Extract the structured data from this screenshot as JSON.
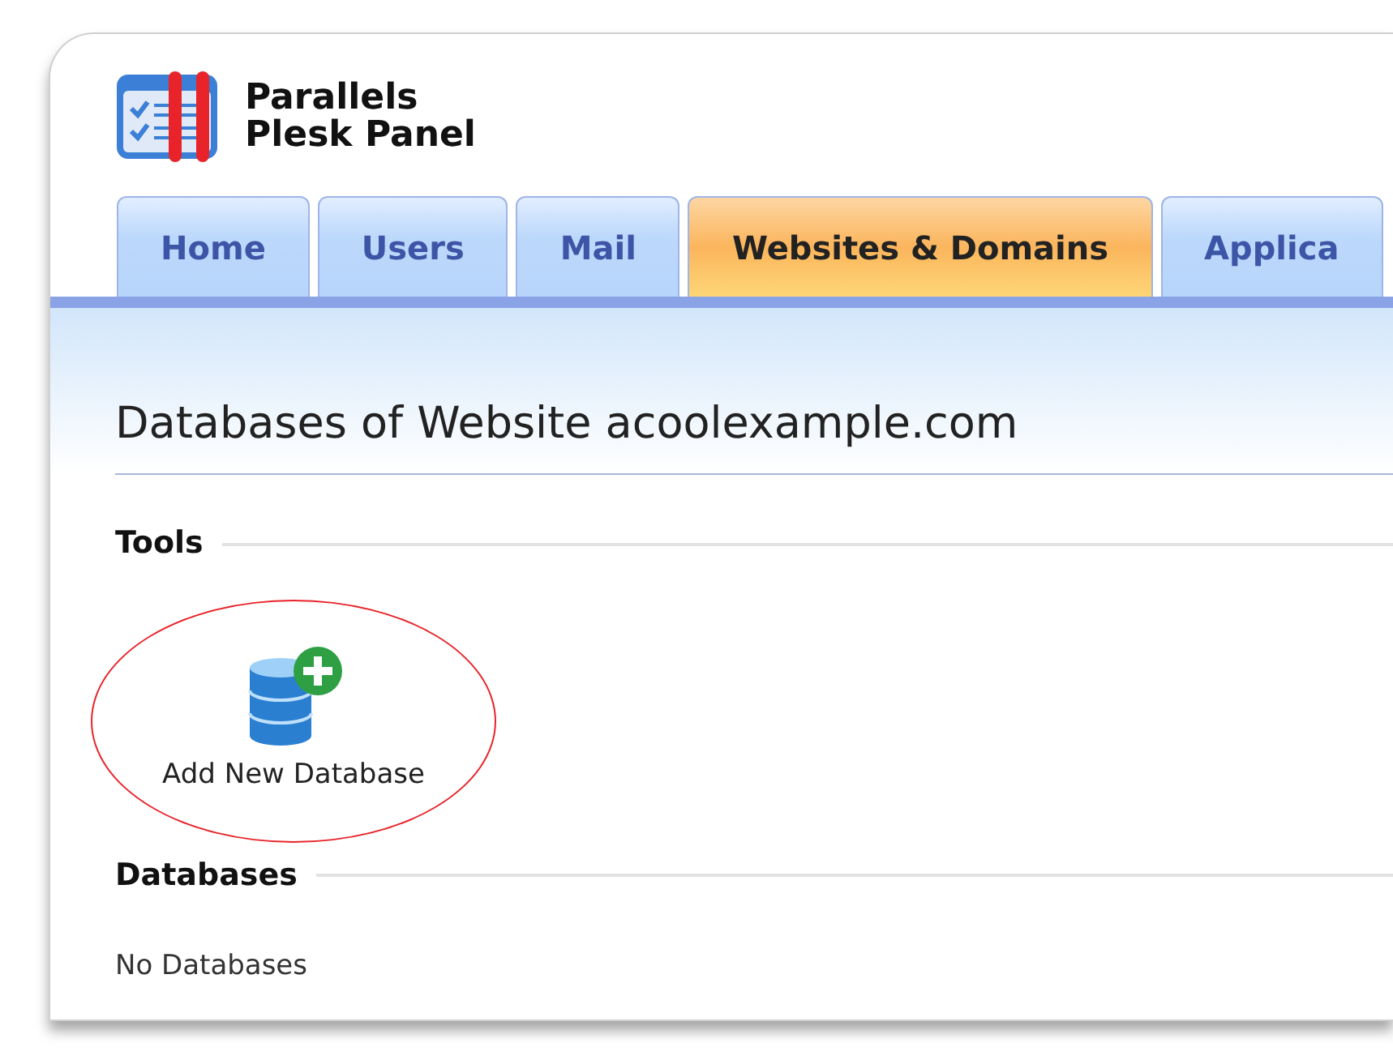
{
  "logo": {
    "line_1": "Parallels",
    "line_2": "Plesk Panel"
  },
  "tabs": [
    {
      "label": "Home",
      "selected": false
    },
    {
      "label": "Users",
      "selected": false
    },
    {
      "label": "Mail",
      "selected": false
    },
    {
      "label": "Websites & Domains",
      "selected": true
    },
    {
      "label": "Applica",
      "selected": false
    }
  ],
  "page_title": "Databases of Website acoolexample.com",
  "sections": [
    {
      "heading": "Tools",
      "kind": "tools",
      "tools": [
        {
          "label": "Add New Database",
          "highlighted": true
        }
      ]
    },
    {
      "heading": "Databases",
      "kind": "text",
      "text": "No Databases"
    }
  ]
}
